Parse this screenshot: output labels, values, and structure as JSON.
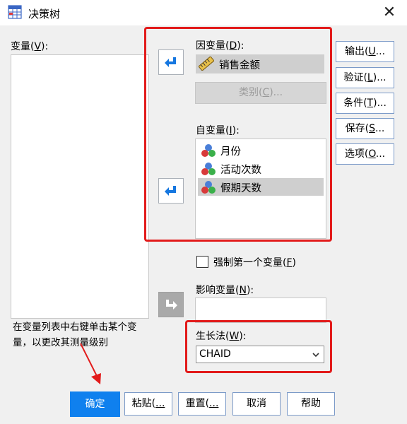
{
  "window": {
    "title": "决策树"
  },
  "left": {
    "variables_label": "变量(",
    "variables_key": "V",
    "variables_suffix": "):",
    "hint": "在变量列表中右键单击某个变量，以更改其测量级别"
  },
  "dependent": {
    "label": "因变量(",
    "key": "D",
    "suffix": "):",
    "value": "销售金额",
    "categories_button": "类别(",
    "categories_key": "C",
    "categories_suffix": ")..."
  },
  "independent": {
    "label": "自变量(",
    "key": "I",
    "suffix": "):",
    "items": [
      "月份",
      "活动次数",
      "假期天数"
    ]
  },
  "force_first": {
    "label": "强制第一个变量(",
    "key": "F",
    "suffix": ")"
  },
  "influence": {
    "label": "影响变量(",
    "key": "N",
    "suffix": "):"
  },
  "growth": {
    "label": "生长法(",
    "key": "W",
    "suffix": "):",
    "selected": "CHAID"
  },
  "side_buttons": [
    {
      "pre": "输出(",
      "key": "U",
      "post": "..."
    },
    {
      "pre": "验证(",
      "key": "L",
      "post": ")..."
    },
    {
      "pre": "条件(",
      "key": "T",
      "post": ")..."
    },
    {
      "pre": "保存(",
      "key": "S",
      "post": "..."
    },
    {
      "pre": "选项(",
      "key": "O",
      "post": "..."
    }
  ],
  "bottom_buttons": {
    "ok": "确定",
    "paste_pre": "粘贴(",
    "paste_post": "...",
    "reset_pre": "重置(",
    "reset_post": "...",
    "cancel": "取消",
    "help": "帮助"
  },
  "colors": {
    "annotation": "#e21b1b",
    "primary": "#0f80ee",
    "arrow": "#1677e0"
  }
}
